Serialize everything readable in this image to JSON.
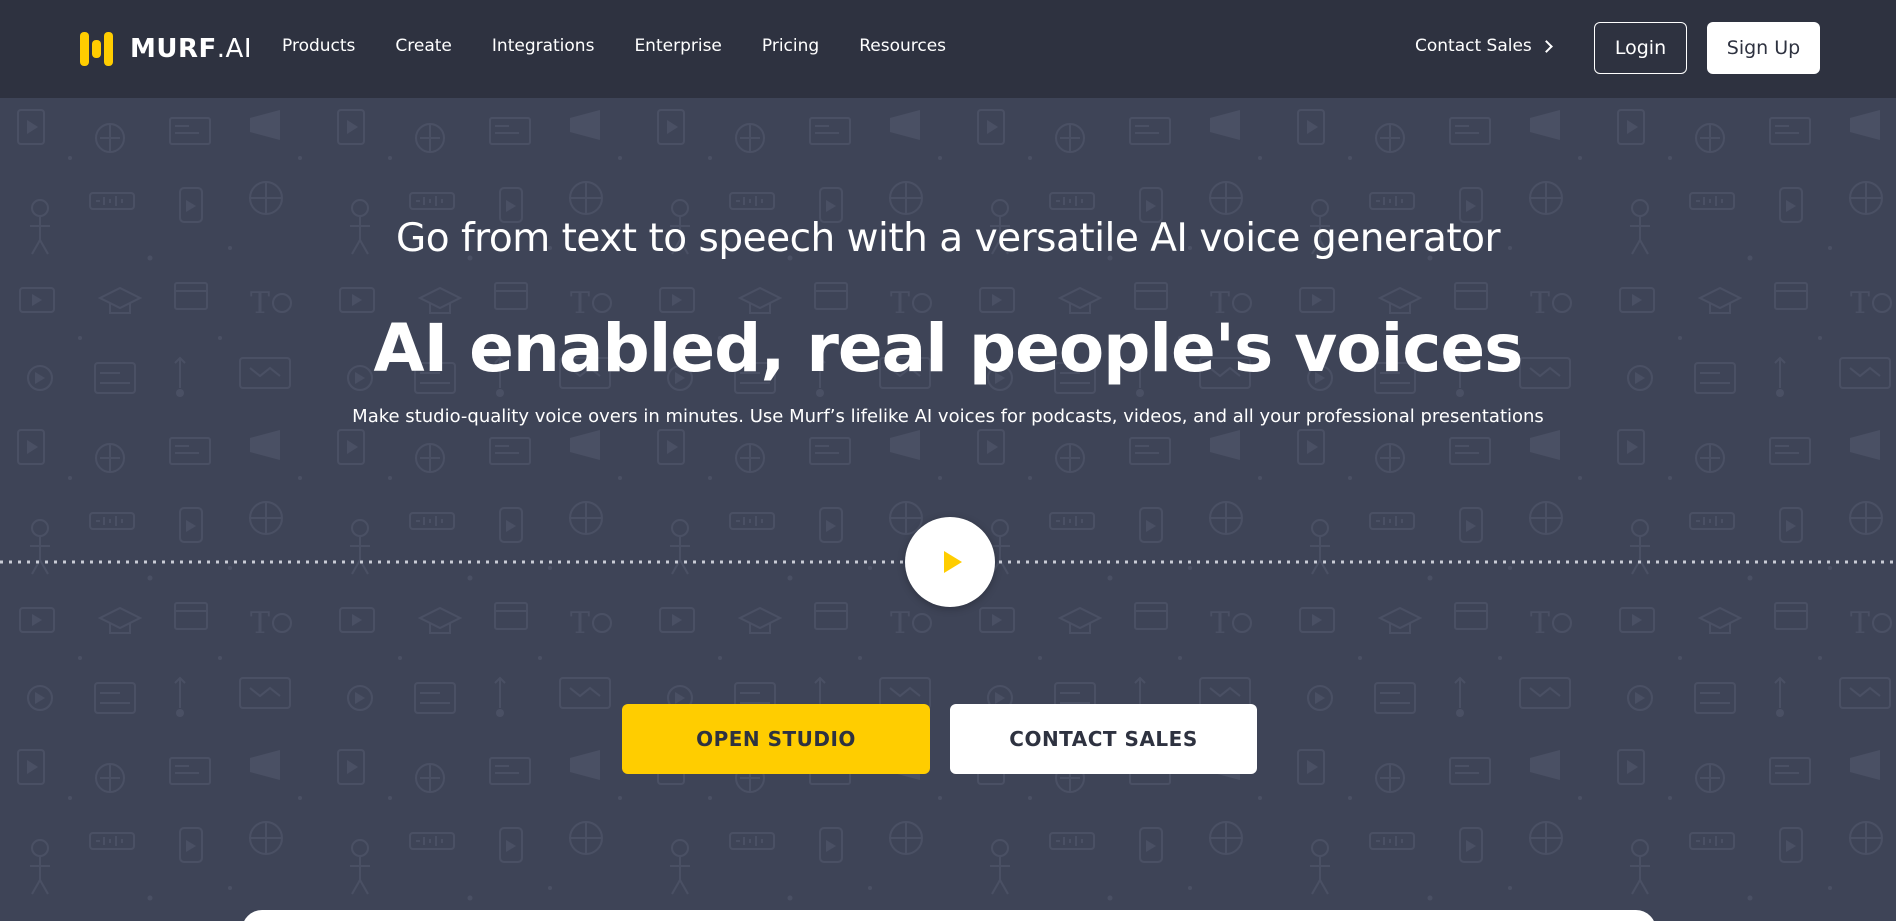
{
  "brand": {
    "name_main": "MURF",
    "name_suffix": ".AI",
    "accent_color": "#ffcd00",
    "logo_icon": "murf-logo-icon"
  },
  "nav": {
    "items": [
      {
        "label": "Products"
      },
      {
        "label": "Create"
      },
      {
        "label": "Integrations"
      },
      {
        "label": "Enterprise"
      },
      {
        "label": "Pricing"
      },
      {
        "label": "Resources"
      }
    ],
    "contact_sales": "Contact Sales",
    "login": "Login",
    "signup": "Sign Up"
  },
  "hero": {
    "subtitle": "Go from text to speech with a versatile AI voice generator",
    "headline": "AI enabled, real people's voices",
    "description": "Make studio-quality voice overs in minutes. Use Murf’s lifelike AI voices for podcasts, videos, and all your professional presentations",
    "play_icon": "play-icon",
    "primary_cta": "OPEN STUDIO",
    "secondary_cta": "CONTACT SALES",
    "background_color": "#3e4457",
    "nav_color": "#2e3240"
  }
}
